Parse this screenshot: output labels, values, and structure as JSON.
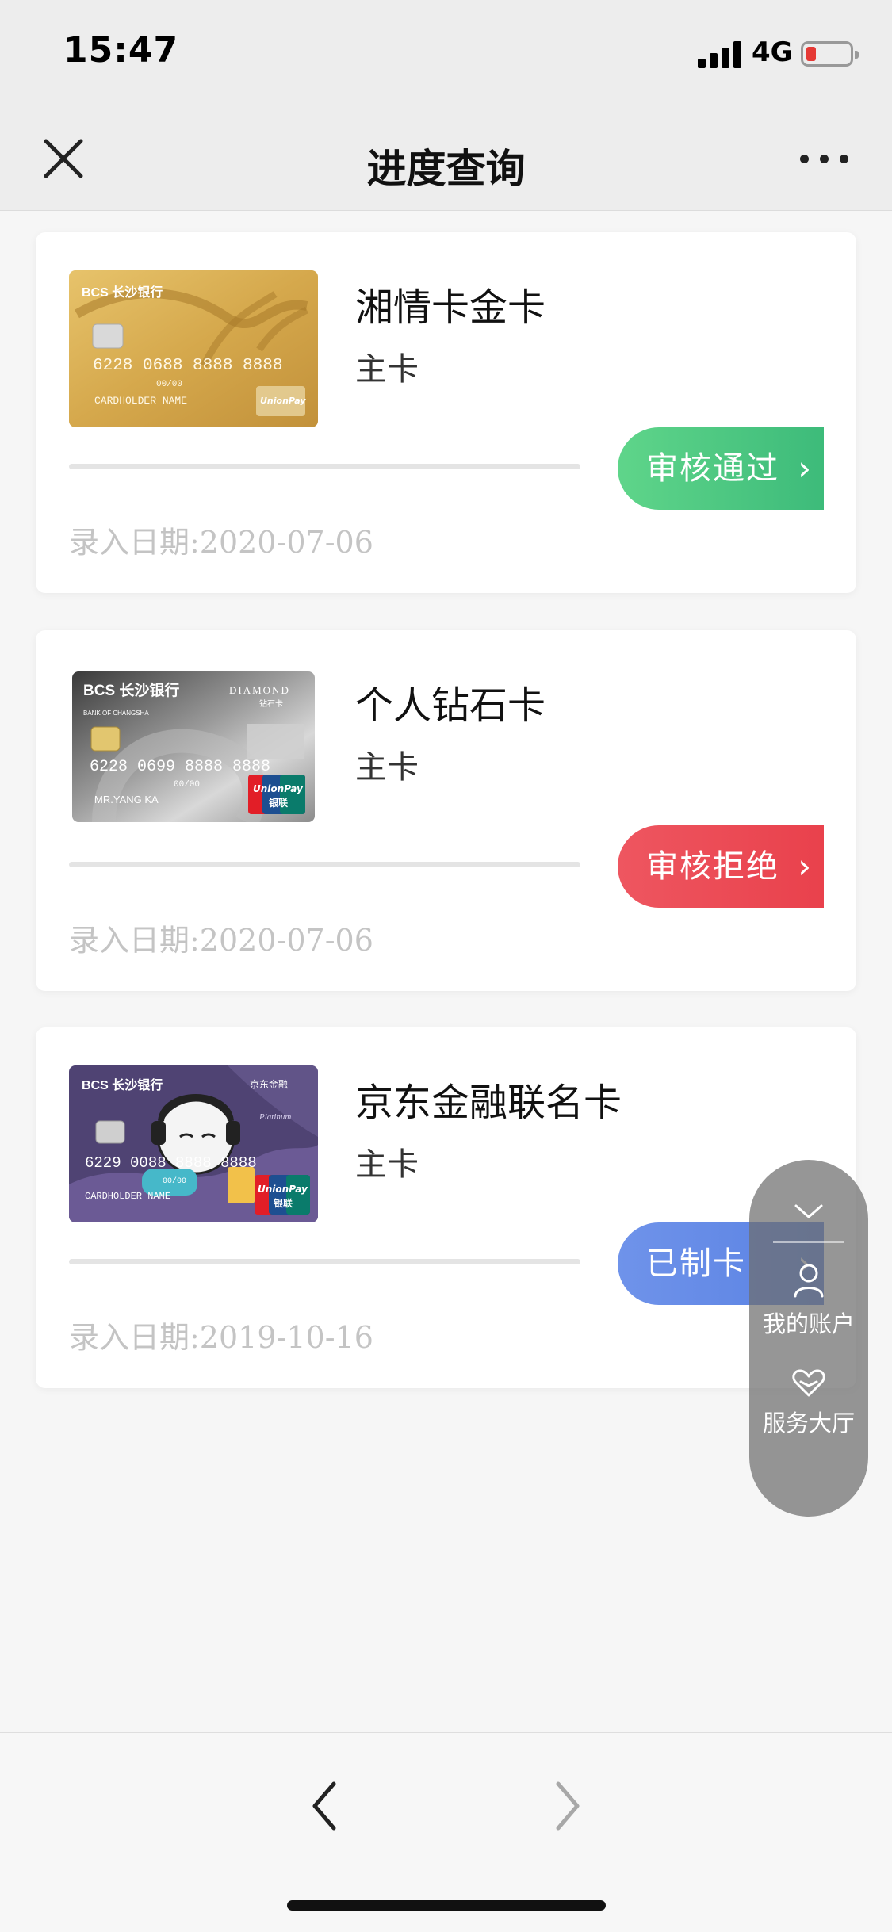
{
  "status_bar": {
    "time": "15:47",
    "network": "4G"
  },
  "nav": {
    "title": "进度查询"
  },
  "cards": [
    {
      "name": "湘情卡金卡",
      "type": "主卡",
      "status": "审核通过",
      "status_color": "#4ccf7c",
      "date": "录入日期:2020-07-06"
    },
    {
      "name": "个人钻石卡",
      "type": "主卡",
      "status": "审核拒绝",
      "status_color": "#ee4d55",
      "date": "录入日期:2020-07-06"
    },
    {
      "name": "京东金融联名卡",
      "type": "主卡",
      "status": "已制卡",
      "status_color": "#5b86e8",
      "date": "录入日期:2019-10-16"
    }
  ],
  "card_images": {
    "gold": {
      "bank": "BCS 长沙银行",
      "number": "6228 0688 8888 8888",
      "holder": "CARDHOLDER NAME",
      "valid": "00/00"
    },
    "diamond": {
      "bank": "BCS 长沙银行",
      "tier": "DIAMOND",
      "tier_cn": "钻石卡",
      "bank_en": "BANK OF CHANGSHA",
      "number": "6228 0699 8888 8888",
      "holder": "MR.YANG KA",
      "valid": "00/00"
    },
    "jd": {
      "bank": "BCS 长沙银行",
      "partner": "京东金融",
      "tier": "Platinum",
      "number": "6229 0088 8888 8888",
      "holder": "CARDHOLDER NAME",
      "valid": "00/00"
    }
  },
  "union_pay": {
    "en": "UnionPay",
    "cn": "银联"
  },
  "float_panel": {
    "my_account": "我的账户",
    "service_hall": "服务大厅"
  },
  "colors": {
    "approved": "#4ccf7c",
    "rejected": "#ee4d55",
    "made": "#5b86e8"
  }
}
